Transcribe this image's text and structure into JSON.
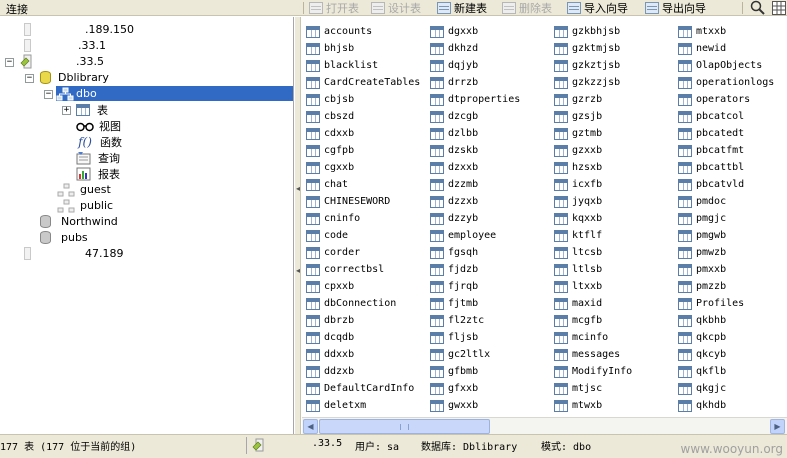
{
  "toolbar": {
    "connection_label": "连接",
    "buttons": [
      {
        "label": "打开表",
        "icon": "open-table-icon",
        "enabled": false
      },
      {
        "label": "设计表",
        "icon": "design-table-icon",
        "enabled": false
      },
      {
        "label": "新建表",
        "icon": "new-table-icon",
        "enabled": true
      },
      {
        "label": "删除表",
        "icon": "delete-table-icon",
        "enabled": false
      },
      {
        "label": "导入向导",
        "icon": "import-wizard-icon",
        "enabled": true
      },
      {
        "label": "导出向导",
        "icon": "export-wizard-icon",
        "enabled": true
      }
    ],
    "search_icon": "search-icon",
    "view_icon": "grid-view-icon"
  },
  "tree": {
    "nodes": [
      {
        "label": ".189.150",
        "icon": "server-icon"
      },
      {
        "label": ".33.1",
        "icon": "server-icon"
      },
      {
        "label": ".33.5",
        "icon": "server-connected-icon",
        "expander": "-"
      },
      {
        "label": "Dblibrary",
        "icon": "database-open-icon",
        "expander": "-"
      },
      {
        "label": "dbo",
        "icon": "schema-icon",
        "expander": "-",
        "selected": true
      },
      {
        "label": "表",
        "icon": "table-icon",
        "expander": "+"
      },
      {
        "label": "视图",
        "icon": "view-glasses-icon"
      },
      {
        "label": "函数",
        "icon": "function-icon"
      },
      {
        "label": "查询",
        "icon": "query-icon"
      },
      {
        "label": "报表",
        "icon": "report-icon"
      },
      {
        "label": "guest",
        "icon": "schema-icon"
      },
      {
        "label": "public",
        "icon": "schema-icon"
      },
      {
        "label": "Northwind",
        "icon": "database-icon"
      },
      {
        "label": "pubs",
        "icon": "database-icon"
      },
      {
        "label": "47.189",
        "icon": "server-icon"
      }
    ]
  },
  "tables": {
    "columns": [
      [
        "accounts",
        "bhjsb",
        "blacklist",
        "CardCreateTables",
        "cbjsb",
        "cbszd",
        "cdxxb",
        "cgfpb",
        "cgxxb",
        "chat",
        "CHINESEWORD",
        "cninfo",
        "code",
        "corder",
        "correctbsl",
        "cpxxb",
        "dbConnection",
        "dbrzb",
        "dcqdb",
        "ddxxb",
        "ddzxb",
        "DefaultCardInfo",
        "deletxm"
      ],
      [
        "dgxxb",
        "dkhzd",
        "dqjyb",
        "drrzb",
        "dtproperties",
        "dzcgb",
        "dzlbb",
        "dzskb",
        "dzxxb",
        "dzzmb",
        "dzzxb",
        "dzzyb",
        "employee",
        "fgsqh",
        "fjdzb",
        "fjrqb",
        "fjtmb",
        "fl2ztc",
        "fljsb",
        "gc2ltlx",
        "gfbmb",
        "gfxxb",
        "gwxxb"
      ],
      [
        "gzkbhjsb",
        "gzktmjsb",
        "gzkztjsb",
        "gzkzzjsb",
        "gzrzb",
        "gzsjb",
        "gztmb",
        "gzxxb",
        "hzsxb",
        "icxfb",
        "jyqxb",
        "kqxxb",
        "ktflf",
        "ltcsb",
        "ltlsb",
        "ltxxb",
        "maxid",
        "mcgfb",
        "mcinfo",
        "messages",
        "ModifyInfo",
        "mtjsc",
        "mtwxb"
      ],
      [
        "mtxxb",
        "newid",
        "OlapObjects",
        "operationlogs",
        "operators",
        "pbcatcol",
        "pbcatedt",
        "pbcatfmt",
        "pbcattbl",
        "pbcatvld",
        "pmdoc",
        "pmgjc",
        "pmgwb",
        "pmwzb",
        "pmxxb",
        "pmzzb",
        "Profiles",
        "qkbhb",
        "qkcpb",
        "qkcyb",
        "qkflb",
        "qkgjc",
        "qkhdb"
      ]
    ]
  },
  "statusbar": {
    "table_count": "177 表 (177 位于当前的组)",
    "server": ".33.5",
    "user_label": "用户: sa",
    "database_label": "数据库: Dblibrary",
    "schema_label": "模式: dbo",
    "watermark": "www.wooyun.org"
  },
  "colors": {
    "selection": "#316ac5",
    "chrome": "#ece9d8",
    "scrollbar": "#c1d3fb"
  }
}
